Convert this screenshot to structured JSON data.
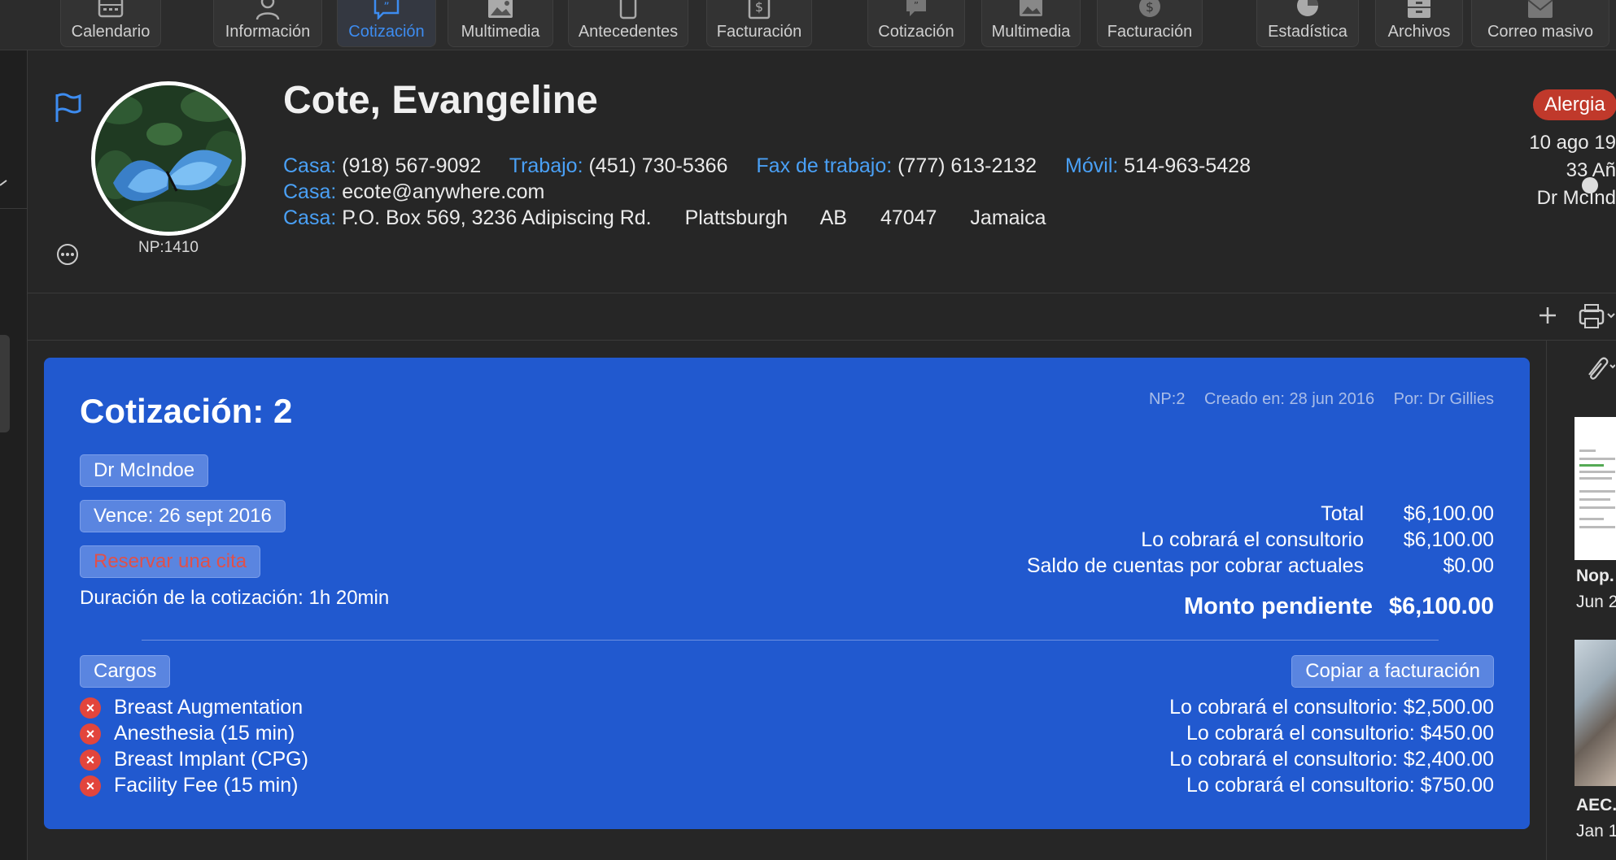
{
  "toolbar": {
    "items": [
      {
        "label": "Calendario",
        "icon": "calendar-icon"
      },
      {
        "label": "Información",
        "icon": "person-icon"
      },
      {
        "label": "Cotización",
        "icon": "quote-bubble-icon",
        "active": true
      },
      {
        "label": "Multimedia",
        "icon": "image-icon"
      },
      {
        "label": "Antecedentes",
        "icon": "tablet-icon"
      },
      {
        "label": "Facturación",
        "icon": "dollar-doc-icon"
      },
      {
        "label": "Cotización",
        "icon": "quote-bubble-icon"
      },
      {
        "label": "Multimedia",
        "icon": "images-icon"
      },
      {
        "label": "Facturación",
        "icon": "dollar-circle-icon"
      },
      {
        "label": "Estadística",
        "icon": "pie-chart-icon"
      },
      {
        "label": "Archivos",
        "icon": "archive-icon"
      },
      {
        "label": "Correo masivo",
        "icon": "envelope-icon"
      }
    ],
    "active_color": "#3d8cf0"
  },
  "patient": {
    "name": "Cote, Evangeline",
    "np": "NP:1410",
    "phones": [
      {
        "key": "Casa:",
        "value": "(918) 567-9092"
      },
      {
        "key": "Trabajo:",
        "value": "(451) 730-5366"
      },
      {
        "key": "Fax de trabajo:",
        "value": "(777) 613-2132"
      },
      {
        "key": "Móvil:",
        "value": "514-963-5428"
      }
    ],
    "email": {
      "key": "Casa:",
      "value": "ecote@anywhere.com"
    },
    "address": {
      "key": "Casa:",
      "street": "P.O. Box 569, 3236 Adipiscing Rd.",
      "city": "Plattsburgh",
      "province": "AB",
      "postal": "47047",
      "country": "Jamaica"
    },
    "allergy_badge": "Alergia",
    "dob": "10 ago 19",
    "age": "33 Añ",
    "doctor": "Dr McInd",
    "label_color": "#4aa0f5",
    "allergy_color": "#c0392b"
  },
  "quote": {
    "title": "Cotización: 2",
    "meta_np": "NP:2",
    "meta_created": "Creado en: 28 jun 2016",
    "meta_by": "Por: Dr Gillies",
    "doctor_pill": "Dr McIndoe",
    "expires_pill": "Vence: 26 sept 2016",
    "book_pill": "Reservar una cita",
    "duration": "Duración de la cotización: 1h 20min",
    "totals": [
      {
        "label": "Total",
        "value": "$6,100.00"
      },
      {
        "label": "Lo cobrará el consultorio",
        "value": "$6,100.00"
      },
      {
        "label": "Saldo de cuentas por cobrar actuales",
        "value": "$0.00"
      }
    ],
    "pending": {
      "label": "Monto pendiente",
      "value": "$6,100.00"
    },
    "charges_pill": "Cargos",
    "copy_button": "Copiar a facturación",
    "charges": [
      {
        "name": "Breast Augmentation",
        "price": "Lo cobrará el consultorio:  $2,500.00"
      },
      {
        "name": "Anesthesia (15 min)",
        "price": "Lo cobrará el consultorio:  $450.00"
      },
      {
        "name": "Breast Implant (CPG)",
        "price": "Lo cobrará el consultorio:  $2,400.00"
      },
      {
        "name": "Facility Fee (15 min)",
        "price": "Lo cobrará el consultorio:  $750.00"
      }
    ],
    "card_color": "#2159cf"
  },
  "attachments": [
    {
      "name": "Nop.",
      "date": "Jun 2"
    },
    {
      "name": "AEC.",
      "date": "Jan 1"
    }
  ]
}
